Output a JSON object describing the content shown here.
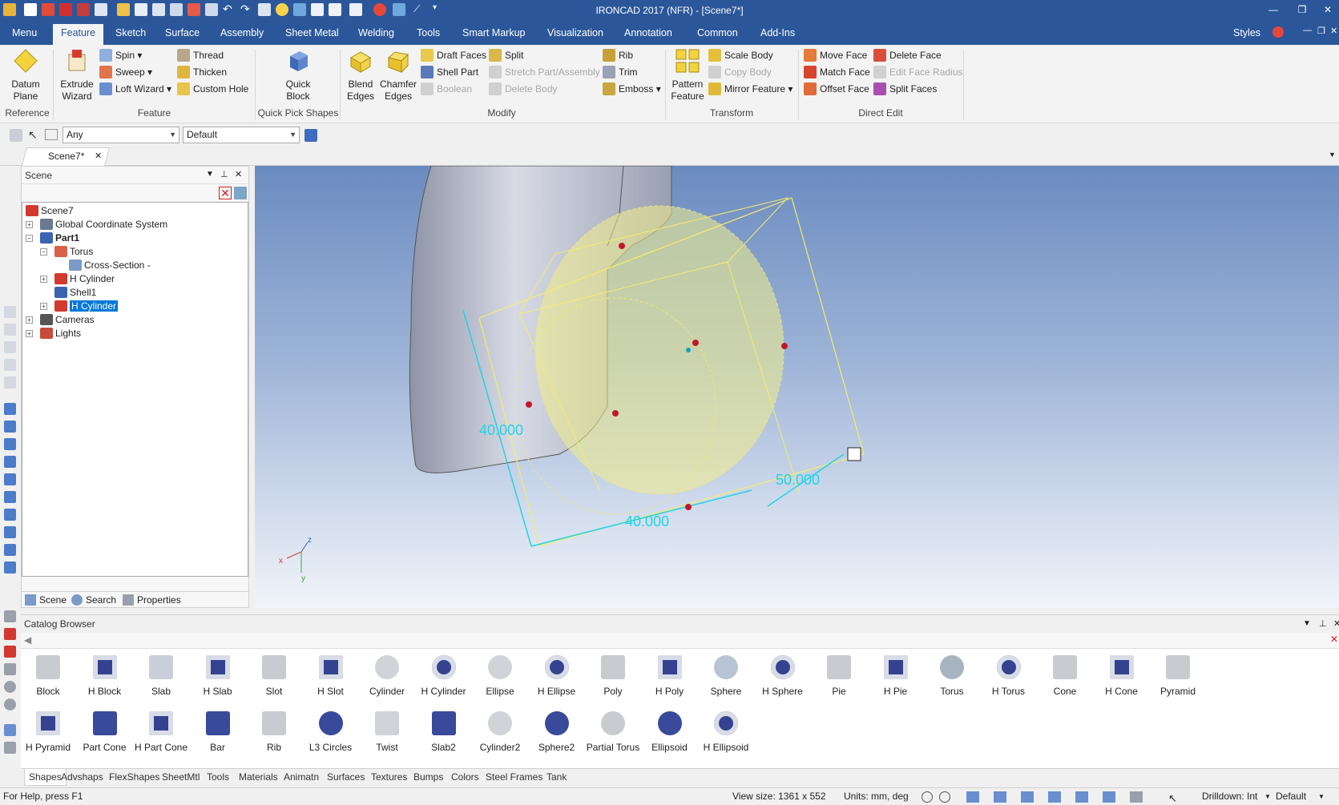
{
  "app": {
    "title": "IRONCAD 2017 (NFR) - [Scene7*]"
  },
  "ribbon_tabs": [
    "Menu",
    "Feature",
    "Sketch",
    "Surface",
    "Assembly",
    "Sheet Metal",
    "Welding",
    "Tools",
    "Smart Markup",
    "Visualization",
    "Annotation",
    "Common",
    "Add-Ins"
  ],
  "ribbon_right": {
    "styles_label": "Styles"
  },
  "groups": {
    "reference": {
      "label": "Reference",
      "datum_plane": "Datum\nPlane"
    },
    "feature": {
      "label": "Feature",
      "extrude_wizard": "Extrude\nWizard",
      "spin": "Spin",
      "sweep": "Sweep",
      "loft_wizard": "Loft Wizard",
      "thread": "Thread",
      "thicken": "Thicken",
      "custom_hole": "Custom Hole"
    },
    "quick_pick": {
      "label": "Quick Pick Shapes",
      "quick_block": "Quick\nBlock"
    },
    "modify": {
      "label": "Modify",
      "blend_edges": "Blend\nEdges",
      "chamfer_edges": "Chamfer\nEdges",
      "draft_faces": "Draft Faces",
      "shell_part": "Shell Part",
      "boolean": "Boolean",
      "split": "Split",
      "stretch": "Stretch Part/Assembly",
      "delete_body": "Delete Body",
      "rib": "Rib",
      "trim": "Trim",
      "emboss": "Emboss"
    },
    "transform": {
      "label": "Transform",
      "pattern_feature": "Pattern\nFeature",
      "scale_body": "Scale Body",
      "copy_body": "Copy Body",
      "mirror_feature": "Mirror Feature"
    },
    "direct_edit": {
      "label": "Direct Edit",
      "move_face": "Move Face",
      "match_face": "Match Face",
      "offset_face": "Offset Face",
      "delete_face": "Delete Face",
      "edit_face_radius": "Edit Face Radius",
      "split_faces": "Split Faces"
    }
  },
  "selection": {
    "filter_value": "Any",
    "style_value": "Default"
  },
  "doc_tab": "Scene7*",
  "scene_panel": {
    "title": "Scene",
    "tree": [
      {
        "label": "Scene7"
      },
      {
        "label": "Global Coordinate System"
      },
      {
        "label": "Part1"
      },
      {
        "label": "Torus"
      },
      {
        "label": "Cross-Section -"
      },
      {
        "label": "H Cylinder"
      },
      {
        "label": "Shell1"
      },
      {
        "label": "H Cylinder"
      },
      {
        "label": "Cameras"
      },
      {
        "label": "Lights"
      }
    ],
    "bottom_tabs": [
      "Scene",
      "Search",
      "Properties"
    ]
  },
  "viewport": {
    "dims": [
      "40.000",
      "40.000",
      "50.000"
    ],
    "axis_labels": [
      "x",
      "z",
      "y"
    ]
  },
  "catalog": {
    "title": "Catalog Browser",
    "row1": [
      "Block",
      "H Block",
      "Slab",
      "H Slab",
      "Slot",
      "H Slot",
      "Cylinder",
      "H Cylinder",
      "Ellipse",
      "H Ellipse",
      "Poly",
      "H Poly",
      "Sphere",
      "H Sphere",
      "Pie",
      "H Pie",
      "Torus",
      "H Torus",
      "Cone",
      "H Cone",
      "Pyramid"
    ],
    "row2": [
      "H Pyramid",
      "Part Cone",
      "H Part Cone",
      "Bar",
      "Rib",
      "L3 Circles",
      "Twist",
      "Slab2",
      "Cylinder2",
      "Sphere2",
      "Partial Torus",
      "Ellipsoid",
      "H Ellipsoid"
    ],
    "tabs": [
      "Shapes",
      "Advshaps",
      "FlexShapes",
      "SheetMtl",
      "Tools",
      "Materials",
      "Animatn",
      "Surfaces",
      "Textures",
      "Bumps",
      "Colors",
      "Steel Frames",
      "Tank"
    ]
  },
  "status": {
    "help": "For Help, press F1",
    "view_size": "View size: 1361 x  552",
    "units": "Units: mm, deg",
    "drilldown": "Drilldown: Int",
    "default": "Default"
  },
  "colors": {
    "accent": "#2b579a",
    "selection": "#0078d7",
    "dimension": "#22d3e6",
    "handle": "#c0182a"
  }
}
